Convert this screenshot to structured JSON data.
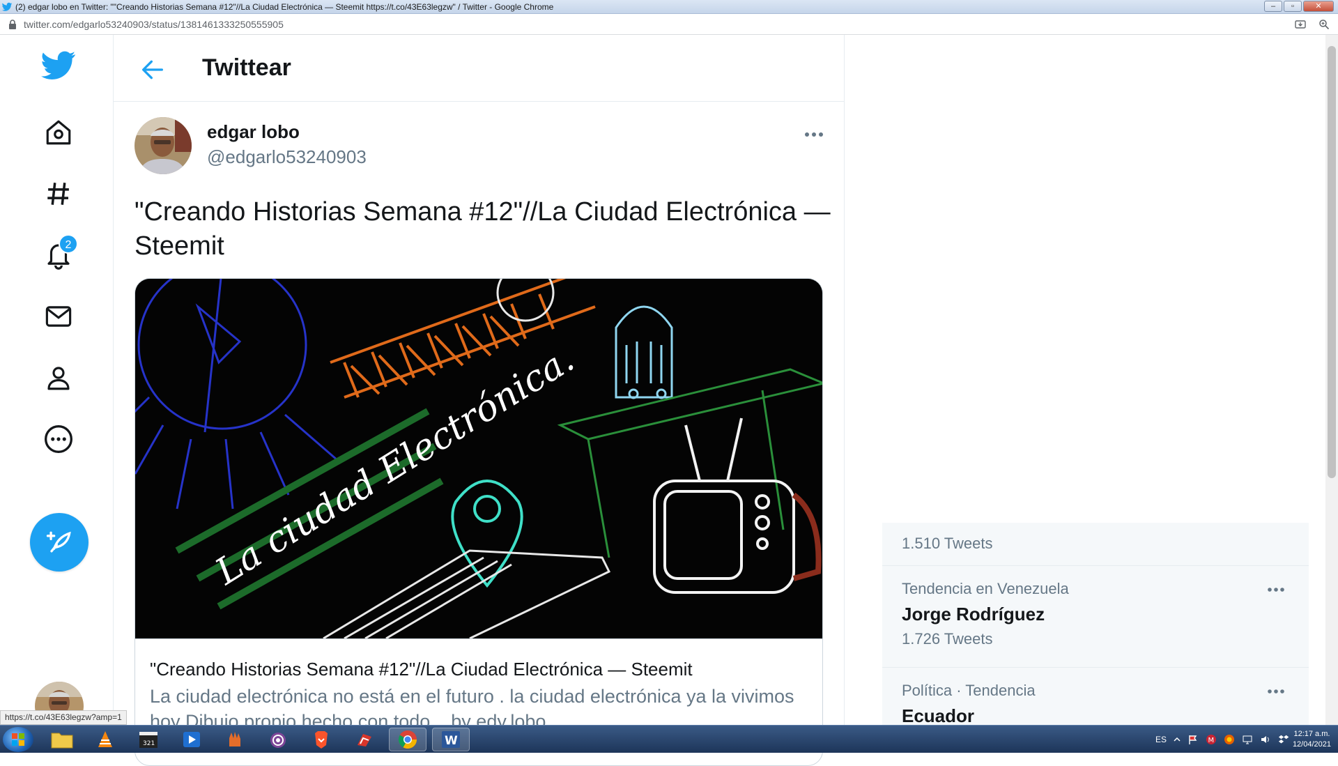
{
  "window": {
    "title": "(2) edgar lobo en Twitter: \"\"Creando Historias Semana #12\"//La Ciudad Electrónica — Steemit https://t.co/43E63legzw\" / Twitter - Google Chrome",
    "minimize": "–",
    "maximize": "▫",
    "close": "✕"
  },
  "address": {
    "url": "twitter.com/edgarlo53240903/status/1381461333250555905"
  },
  "nav": {
    "notifications_badge": "2"
  },
  "header": {
    "title": "Twittear"
  },
  "tweet": {
    "author_name": "edgar lobo",
    "author_handle": "@edgarlo53240903",
    "text": "\"Creando Historias Semana #12\"//La Ciudad Electrónica — Steemit",
    "card": {
      "image_caption": "La ciudad Electrónica.",
      "title": "\"Creando Historias Semana #12\"//La Ciudad Electrónica — Steemit",
      "description": "La ciudad electrónica no está en el futuro . la ciudad electrónica ya la vivimos hoy Dibujo propio hecho con todo... by edy.lobo"
    }
  },
  "trends": [
    {
      "meta": "",
      "name": "",
      "count": "1.510 Tweets"
    },
    {
      "meta": "Tendencia en Venezuela",
      "name": "Jorge Rodríguez",
      "count": "1.726 Tweets"
    },
    {
      "meta": "Política · Tendencia",
      "name": "Ecuador",
      "count": ""
    }
  ],
  "status_bar": {
    "url": "https://t.co/43E63legzw?amp=1"
  },
  "taskbar": {
    "language": "ES",
    "time": "12:17 a.m.",
    "date": "12/04/2021"
  },
  "colors": {
    "twitter_blue": "#1da1f2",
    "text_primary": "#14171a",
    "text_secondary": "#657786"
  }
}
